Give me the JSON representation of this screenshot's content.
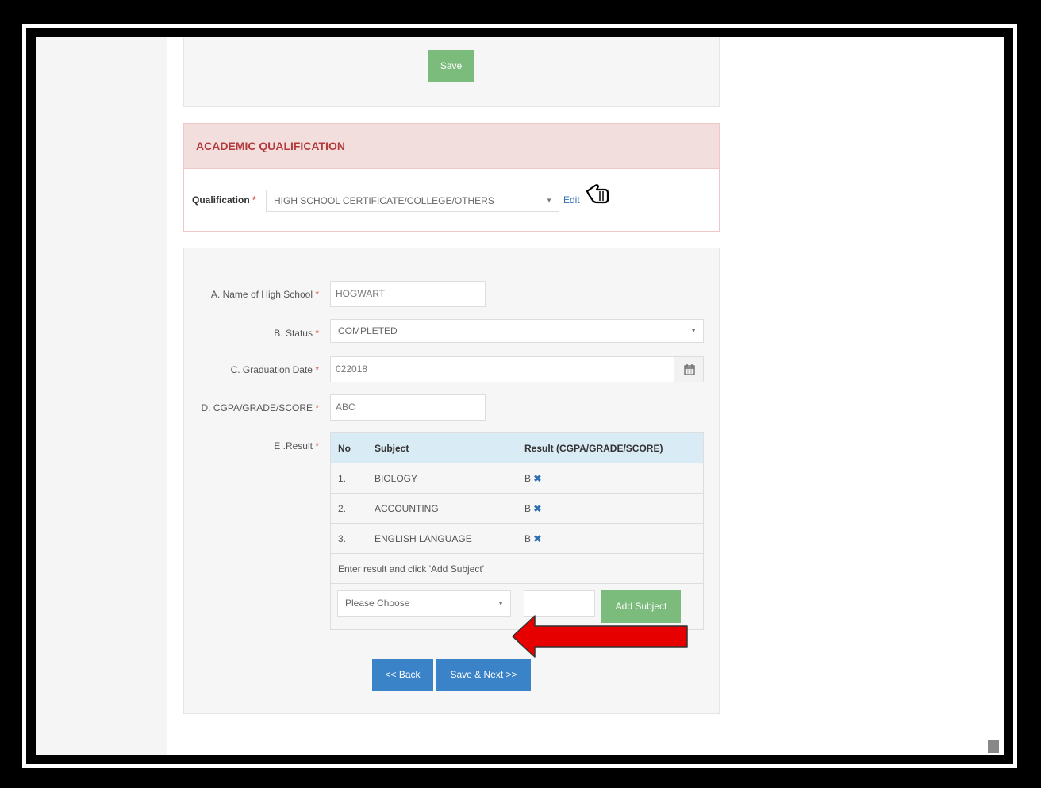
{
  "save_panel": {
    "save_label": "Save"
  },
  "academic": {
    "heading": "ACADEMIC QUALIFICATION",
    "qualification_label": "Qualification",
    "required_mark": "*",
    "qualification_value": "HIGH SCHOOL CERTIFICATE/COLLEGE/OTHERS",
    "edit_label": "Edit"
  },
  "form": {
    "school_label": "A. Name of High School",
    "school_value": "HOGWART",
    "status_label": "B. Status",
    "status_value": "COMPLETED",
    "grad_label": "C. Graduation Date",
    "grad_value": "022018",
    "cgpa_label": "D. CGPA/GRADE/SCORE",
    "cgpa_value": "ABC",
    "result_label": "E .Result"
  },
  "results_table": {
    "headers": [
      "No",
      "Subject",
      "Result (CGPA/GRADE/SCORE)"
    ],
    "rows": [
      {
        "no": "1.",
        "subject": "BIOLOGY",
        "result": "B"
      },
      {
        "no": "2.",
        "subject": "ACCOUNTING",
        "result": "B"
      },
      {
        "no": "3.",
        "subject": "ENGLISH LANGUAGE",
        "result": "B"
      }
    ],
    "hint": "Enter result and click 'Add Subject'",
    "subject_placeholder": "Please Choose",
    "add_subject_label": "Add Subject"
  },
  "nav": {
    "back_label": "<< Back",
    "next_label": "Save & Next >>"
  },
  "colors": {
    "accent_blue": "#3b83c8",
    "accent_green": "#7bbb7c",
    "alert_red": "#b33a3a",
    "annotation_arrow": "#e60000"
  },
  "icons": {
    "calendar": "calendar-icon",
    "remove": "close-icon",
    "pointer": "pointing-hand-icon",
    "dropdown": "chevron-down-icon"
  }
}
